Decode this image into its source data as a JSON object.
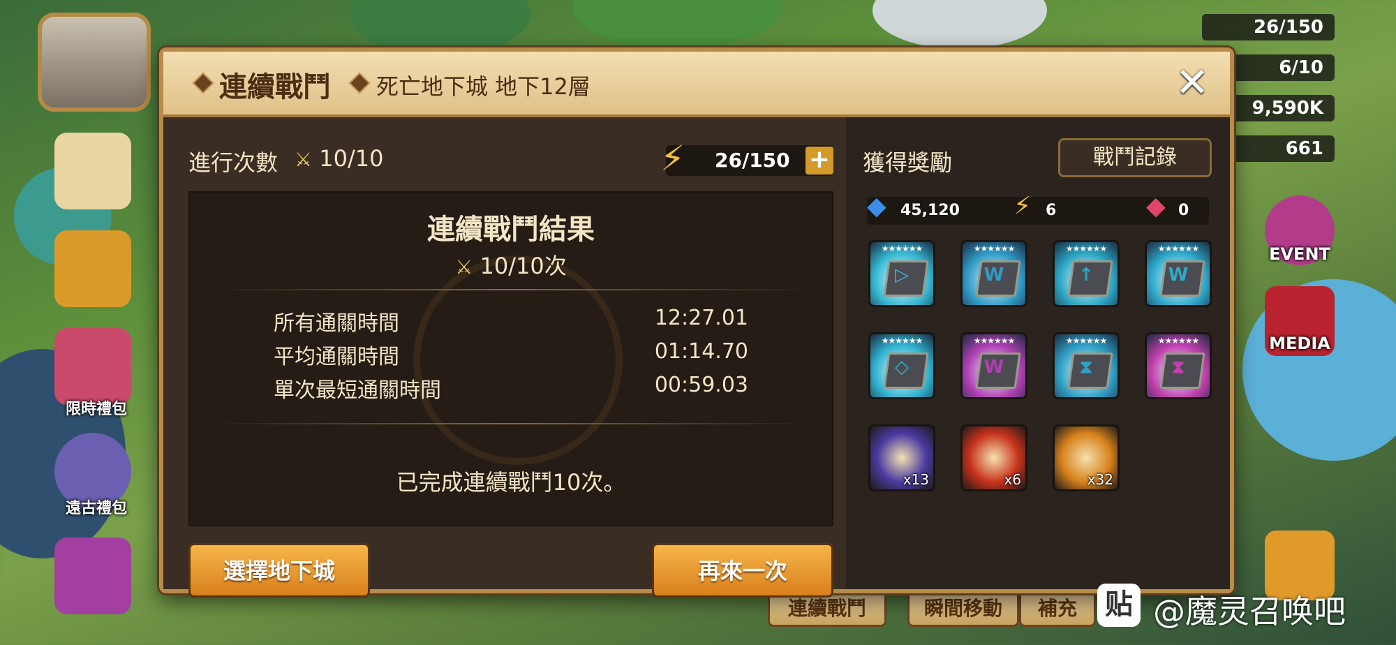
{
  "dialog": {
    "title": "連續戰鬥",
    "subtitle": "死亡地下城 地下12層",
    "close_label": "✕"
  },
  "progress": {
    "label": "進行次數",
    "value": "10/10"
  },
  "energy": {
    "value": "26/150",
    "plus_label": "+"
  },
  "results": {
    "title": "連續戰鬥結果",
    "count": "10/10次",
    "stats": [
      {
        "label": "所有通關時間",
        "value": "12:27.01"
      },
      {
        "label": "平均通關時間",
        "value": "01:14.70"
      },
      {
        "label": "單次最短通關時間",
        "value": "00:59.03"
      }
    ],
    "complete_message": "已完成連續戰鬥10次。"
  },
  "buttons": {
    "select_dungeon": "選擇地下城",
    "retry": "再來一次"
  },
  "rewards": {
    "title": "獲得獎勵",
    "log_button": "戰鬥記錄",
    "currencies": [
      {
        "icon": "crystal-icon",
        "value": "45,120",
        "color": "#3a8ee6"
      },
      {
        "icon": "energy-icon",
        "value": "6",
        "color": "#f3c43a"
      },
      {
        "icon": "red-gem-icon",
        "value": "0",
        "color": "#e2456a"
      }
    ],
    "runes": [
      {
        "name": "rune-1",
        "glyph": "▷",
        "color": "#36b9d3",
        "stars": "★★★★★★"
      },
      {
        "name": "rune-2",
        "glyph": "W",
        "color": "#2f9bc8",
        "stars": "★★★★★★"
      },
      {
        "name": "rune-3",
        "glyph": "↑",
        "color": "#2ba6c4",
        "stars": "★★★★★★"
      },
      {
        "name": "rune-4",
        "glyph": "W",
        "color": "#2fa9cc",
        "stars": "★★★★★★"
      },
      {
        "name": "rune-5",
        "glyph": "◇",
        "color": "#31b3cf",
        "stars": "★★★★★★"
      },
      {
        "name": "rune-6",
        "glyph": "W",
        "color": "#b03fb3",
        "stars": "★★★★★★"
      },
      {
        "name": "rune-7",
        "glyph": "⧗",
        "color": "#2f9fc4",
        "stars": "★★★★★★"
      },
      {
        "name": "rune-8",
        "glyph": "⧗",
        "color": "#c13fae",
        "stars": "★★★★★★"
      }
    ],
    "items": [
      {
        "name": "scroll-item",
        "qty": "x13",
        "color": "#4b3aa0"
      },
      {
        "name": "fire-essence-item",
        "qty": "x6",
        "color": "#c8321c"
      },
      {
        "name": "coin-item",
        "qty": "x32",
        "color": "#d7821c"
      }
    ]
  },
  "hud": {
    "energy": "26/150",
    "arena": "6/10",
    "mana": "9,590K",
    "crystal": "661",
    "event_label": "EVENT",
    "media_label": "MEDIA",
    "left_pack1": "限時禮包",
    "left_pack2": "遠古禮包",
    "bottom_tab1": "連續戰鬥",
    "bottom_tab2": "瞬間移動",
    "bottom_tab3": "補充"
  },
  "watermark": {
    "icon": "贴",
    "text": "@魔灵召唤吧"
  }
}
